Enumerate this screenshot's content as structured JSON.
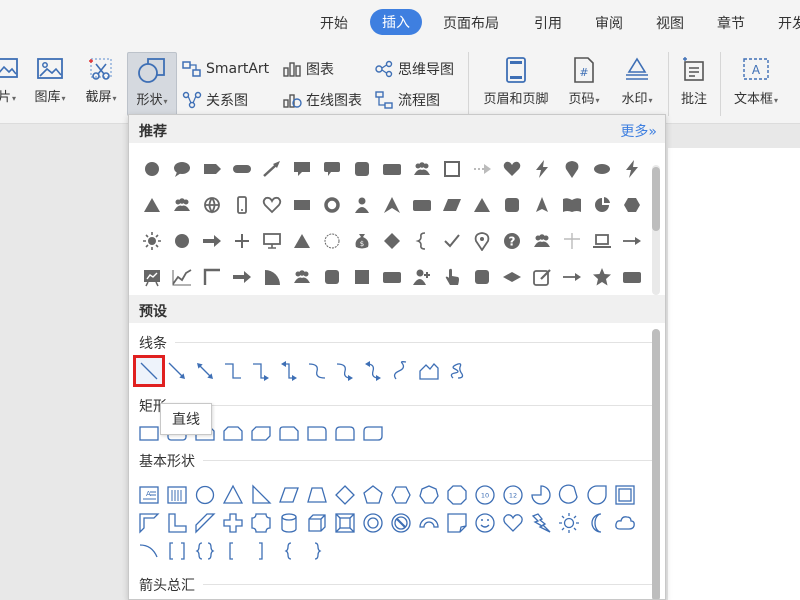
{
  "menu": {
    "tabs": [
      {
        "label": "开始",
        "active": false
      },
      {
        "label": "插入",
        "active": true
      },
      {
        "label": "页面布局",
        "active": false
      },
      {
        "label": "引用",
        "active": false
      },
      {
        "label": "审阅",
        "active": false
      },
      {
        "label": "视图",
        "active": false
      },
      {
        "label": "章节",
        "active": false
      },
      {
        "label": "开发",
        "active": false
      }
    ]
  },
  "ribbon": {
    "picture_partial": "片",
    "gallery": "图库",
    "screenshot": "截屏",
    "shapes": "形状",
    "smartart": "SmartArt",
    "chart": "图表",
    "mindmap": "思维导图",
    "relation": "关系图",
    "online_chart": "在线图表",
    "flowchart": "流程图",
    "header_footer": "页眉和页脚",
    "page_number": "页码",
    "watermark": "水印",
    "comment": "批注",
    "textbox": "文本框"
  },
  "dropdown": {
    "recommended_title": "推荐",
    "more_link": "更多»",
    "presets_title": "预设",
    "lines_label": "线条",
    "rect_label": "矩形",
    "basic_label": "基本形状",
    "arrows_label": "箭头总汇",
    "tooltip": "直线"
  },
  "colors": {
    "accent": "#3e7fe0",
    "recommended_icon": "#666666",
    "preset_icon": "#3e6fb5",
    "highlight_border": "#e02020"
  },
  "recommended_icons": [
    "circle",
    "speech-bubble",
    "tag-shape",
    "rounded-bar",
    "arrow-diagonal",
    "callout-rect",
    "callout-rounded",
    "rounded-square",
    "rounded-rect",
    "people-group",
    "square-outline",
    "dotted-arrow",
    "heart",
    "lightning",
    "map-pin",
    "ellipse",
    "lightning",
    "triangle",
    "people-group",
    "globe",
    "phone",
    "heart-outline",
    "rect",
    "ring",
    "person",
    "arrowhead",
    "rounded-rect",
    "parallelogram",
    "triangle",
    "rounded-square",
    "triangle-slim",
    "book",
    "circle-partial",
    "hexagon",
    "sun",
    "circle",
    "arrow-right",
    "plus",
    "monitor",
    "triangle",
    "circle-outline",
    "money-bag",
    "diamond",
    "brace-left",
    "check",
    "map-pin-outline",
    "question-circle",
    "people-group",
    "cross-thin",
    "laptop",
    "arrow-long-right",
    "chart-board",
    "line-chart",
    "corner",
    "arrow-right",
    "quarter-circle",
    "people-group",
    "rounded-square",
    "square",
    "rounded-rect",
    "person-add",
    "hand-pointer",
    "rounded-square",
    "diamond-wide",
    "edit-box",
    "arrow-long-right",
    "star",
    "rounded-rect"
  ],
  "preset_lines": [
    "line",
    "arrow-line",
    "double-arrow-line",
    "elbow-connector",
    "elbow-arrow-connector",
    "elbow-double-arrow",
    "curved-connector",
    "curved-arrow-connector",
    "curved-double-arrow",
    "curve",
    "freeform",
    "scribble"
  ],
  "preset_rects": [
    "rectangle",
    "rounded-rectangle",
    "snip-single-corner",
    "snip-same-side",
    "snip-diagonal",
    "snip-round",
    "round-single-corner",
    "round-same-side",
    "round-diagonal"
  ],
  "preset_basic": [
    "text-box",
    "vertical-text-box",
    "oval",
    "isosceles-triangle",
    "right-triangle",
    "parallelogram",
    "trapezoid",
    "diamond",
    "pentagon",
    "hexagon",
    "heptagon",
    "octagon",
    "decagon",
    "dodecagon",
    "pie",
    "chord",
    "teardrop",
    "frame",
    "half-frame",
    "l-shape",
    "diagonal-stripe",
    "cross",
    "plaque",
    "can",
    "cube",
    "bevel",
    "donut",
    "no-symbol",
    "block-arc",
    "folded-corner",
    "smiley-face",
    "heart",
    "lightning-bolt",
    "sun",
    "moon",
    "cloud",
    "arc",
    "double-bracket",
    "double-brace",
    "left-bracket",
    "right-bracket",
    "left-brace",
    "right-brace"
  ]
}
